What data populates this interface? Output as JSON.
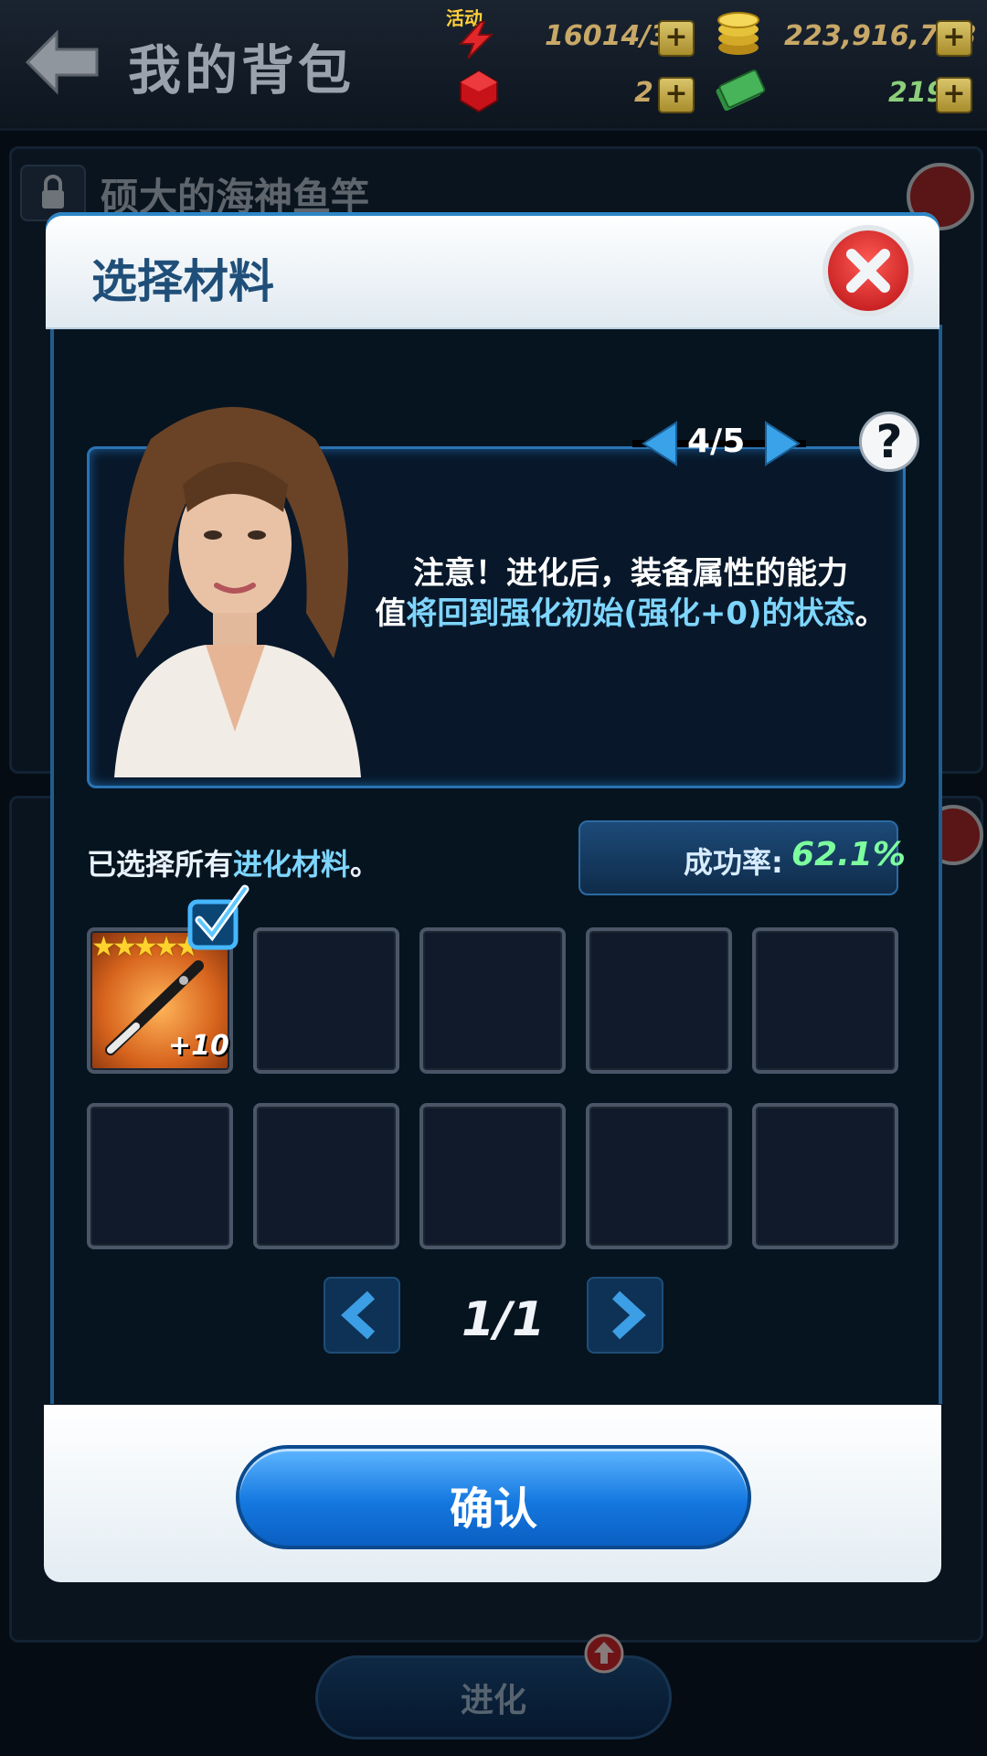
{
  "header": {
    "title": "我的背包",
    "activity_label": "活动",
    "energy": "16014/30",
    "gold": "223,916,703",
    "gems": "2",
    "cash": "219"
  },
  "background": {
    "item_name": "硕大的海神鱼竿",
    "evolve_label": "进化"
  },
  "modal": {
    "title": "选择材料",
    "pager": "4/5",
    "notice_white_1": "注意！进化后，装备属性的能力",
    "notice_white_2": "值",
    "notice_highlight": "将回到强化初始(强化+0)的状态",
    "notice_end": "。",
    "selected_prefix": "已选择所有",
    "selected_highlight": "进化材料",
    "selected_suffix": "。",
    "success_label": "成功率:",
    "success_value": "62.1%",
    "slots": [
      {
        "filled": true,
        "level": "+10",
        "stars": 5,
        "checked": true
      },
      {
        "filled": false
      },
      {
        "filled": false
      },
      {
        "filled": false
      },
      {
        "filled": false
      },
      {
        "filled": false
      },
      {
        "filled": false
      },
      {
        "filled": false
      },
      {
        "filled": false
      },
      {
        "filled": false
      }
    ],
    "page_indicator": "1/1",
    "confirm_label": "确认"
  },
  "colors": {
    "accent_blue": "#1478e0",
    "highlight_text": "#7ed6ff",
    "success_green": "#7dff9e",
    "close_red": "#d01d22"
  }
}
